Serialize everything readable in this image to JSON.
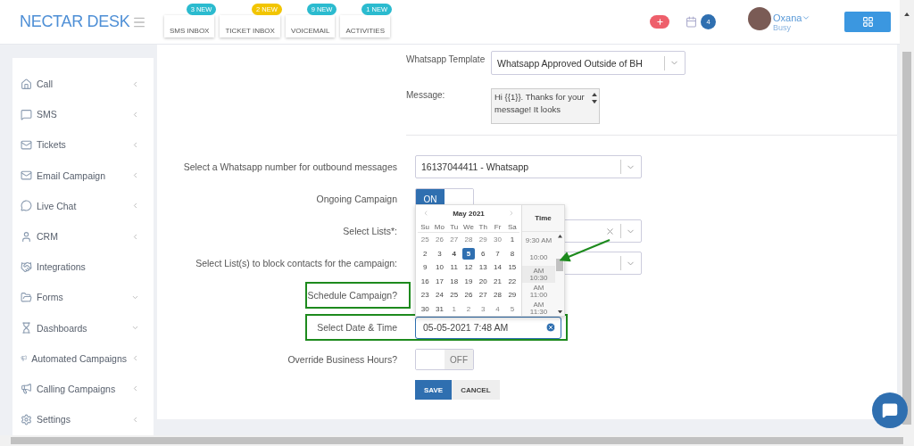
{
  "header": {
    "logo": "NECTAR DESK",
    "inbox_tabs": [
      {
        "label": "SMS INBOX",
        "badge": "3 NEW",
        "color": "#2bbbcf"
      },
      {
        "label": "TICKET INBOX",
        "badge": "2 NEW",
        "color": "#f2c500"
      },
      {
        "label": "VOICEMAIL",
        "badge": "9 NEW",
        "color": "#2bbbcf"
      },
      {
        "label": "ACTIVITIES",
        "badge": "1 NEW",
        "color": "#2bbbcf"
      }
    ],
    "calendar_badge": "4",
    "user": {
      "name": "Oxana",
      "status": "Busy"
    }
  },
  "sidebar": {
    "items": [
      {
        "label": "Call",
        "kind": "side"
      },
      {
        "label": "SMS",
        "kind": "side"
      },
      {
        "label": "Tickets",
        "kind": "side"
      },
      {
        "label": "Email Campaign",
        "kind": "side"
      },
      {
        "label": "Live Chat",
        "kind": "side"
      },
      {
        "label": "CRM",
        "kind": "side"
      },
      {
        "label": "Integrations",
        "kind": "plain"
      },
      {
        "label": "Forms",
        "kind": "down"
      },
      {
        "label": "Dashboards",
        "kind": "down"
      },
      {
        "label": "Automated Campaigns",
        "kind": "side"
      },
      {
        "label": "Calling Campaigns",
        "kind": "side"
      },
      {
        "label": "Settings",
        "kind": "side"
      }
    ]
  },
  "form": {
    "template": {
      "label": "Whatsapp Template",
      "value": "Whatsapp Approved Outside of BH"
    },
    "message": {
      "label": "Message:",
      "value": "Hi {{1}}. Thanks for your message! It looks"
    },
    "rows": [
      {
        "kind": "select",
        "label": "Select a Whatsapp number for outbound messages",
        "value": "16137044411 - Whatsapp",
        "highlighted": false
      },
      {
        "kind": "toggle",
        "label": "Ongoing Campaign",
        "on": true,
        "text": "ON",
        "highlighted": false
      },
      {
        "kind": "select",
        "label": "Select Lists*:",
        "clearable": true,
        "highlighted": false
      },
      {
        "kind": "select",
        "label": "Select List(s) to block contacts for the campaign:",
        "highlighted": false
      },
      {
        "kind": "label",
        "label": "Schedule Campaign?",
        "highlighted": true
      },
      {
        "kind": "date",
        "label": "Select Date & Time",
        "value": "05-05-2021 7:48 AM",
        "highlighted": true
      },
      {
        "kind": "toggle",
        "label": "Override Business Hours?",
        "on": false,
        "text": "OFF",
        "highlighted": false
      }
    ],
    "buttons": [
      {
        "label": "SAVE",
        "kind": "primary"
      },
      {
        "label": "CANCEL",
        "kind": "secondary"
      }
    ]
  },
  "datepicker": {
    "month": "May 2021",
    "time_title": "Time",
    "weekdays": [
      "Su",
      "Mo",
      "Tu",
      "We",
      "Th",
      "Fr",
      "Sa"
    ],
    "weeks": [
      [
        {
          "d": "25",
          "muted": true,
          "today": false,
          "selected": false
        },
        {
          "d": "26",
          "muted": true,
          "today": false,
          "selected": false
        },
        {
          "d": "27",
          "muted": true,
          "today": false,
          "selected": false
        },
        {
          "d": "28",
          "muted": true,
          "today": false,
          "selected": false
        },
        {
          "d": "29",
          "muted": true,
          "today": false,
          "selected": false
        },
        {
          "d": "30",
          "muted": true,
          "today": false,
          "selected": false
        },
        {
          "d": "1",
          "muted": false,
          "today": false,
          "selected": false
        }
      ],
      [
        {
          "d": "2",
          "muted": false,
          "today": false,
          "selected": false
        },
        {
          "d": "3",
          "muted": false,
          "today": false,
          "selected": false
        },
        {
          "d": "4",
          "muted": false,
          "today": true,
          "selected": false
        },
        {
          "d": "5",
          "muted": false,
          "today": false,
          "selected": true
        },
        {
          "d": "6",
          "muted": false,
          "today": false,
          "selected": false
        },
        {
          "d": "7",
          "muted": false,
          "today": false,
          "selected": false
        },
        {
          "d": "8",
          "muted": false,
          "today": false,
          "selected": false
        }
      ],
      [
        {
          "d": "9",
          "muted": false,
          "today": false,
          "selected": false
        },
        {
          "d": "10",
          "muted": false,
          "today": false,
          "selected": false
        },
        {
          "d": "11",
          "muted": false,
          "today": false,
          "selected": false
        },
        {
          "d": "12",
          "muted": false,
          "today": false,
          "selected": false
        },
        {
          "d": "13",
          "muted": false,
          "today": false,
          "selected": false
        },
        {
          "d": "14",
          "muted": false,
          "today": false,
          "selected": false
        },
        {
          "d": "15",
          "muted": false,
          "today": false,
          "selected": false
        }
      ],
      [
        {
          "d": "16",
          "muted": false,
          "today": false,
          "selected": false
        },
        {
          "d": "17",
          "muted": false,
          "today": false,
          "selected": false
        },
        {
          "d": "18",
          "muted": false,
          "today": false,
          "selected": false
        },
        {
          "d": "19",
          "muted": false,
          "today": false,
          "selected": false
        },
        {
          "d": "20",
          "muted": false,
          "today": false,
          "selected": false
        },
        {
          "d": "21",
          "muted": false,
          "today": false,
          "selected": false
        },
        {
          "d": "22",
          "muted": false,
          "today": false,
          "selected": false
        }
      ],
      [
        {
          "d": "23",
          "muted": false,
          "today": false,
          "selected": false
        },
        {
          "d": "24",
          "muted": false,
          "today": false,
          "selected": false
        },
        {
          "d": "25",
          "muted": false,
          "today": false,
          "selected": false
        },
        {
          "d": "26",
          "muted": false,
          "today": false,
          "selected": false
        },
        {
          "d": "27",
          "muted": false,
          "today": false,
          "selected": false
        },
        {
          "d": "28",
          "muted": false,
          "today": false,
          "selected": false
        },
        {
          "d": "29",
          "muted": false,
          "today": false,
          "selected": false
        }
      ],
      [
        {
          "d": "30",
          "muted": false,
          "today": false,
          "selected": false
        },
        {
          "d": "31",
          "muted": false,
          "today": false,
          "selected": false
        },
        {
          "d": "1",
          "muted": true,
          "today": false,
          "selected": false
        },
        {
          "d": "2",
          "muted": true,
          "today": false,
          "selected": false
        },
        {
          "d": "3",
          "muted": true,
          "today": false,
          "selected": false
        },
        {
          "d": "4",
          "muted": true,
          "today": false,
          "selected": false
        },
        {
          "d": "5",
          "muted": true,
          "today": false,
          "selected": false
        }
      ]
    ],
    "times": [
      {
        "text": "9:30 AM",
        "selected": false
      },
      {
        "text": "10:00",
        "selected": false
      },
      {
        "text": "10:30",
        "suffix": "AM",
        "selected": true
      },
      {
        "text": "11:00",
        "suffix": "AM",
        "selected": false
      },
      {
        "text": "11:30",
        "suffix": "AM",
        "selected": false
      }
    ]
  }
}
